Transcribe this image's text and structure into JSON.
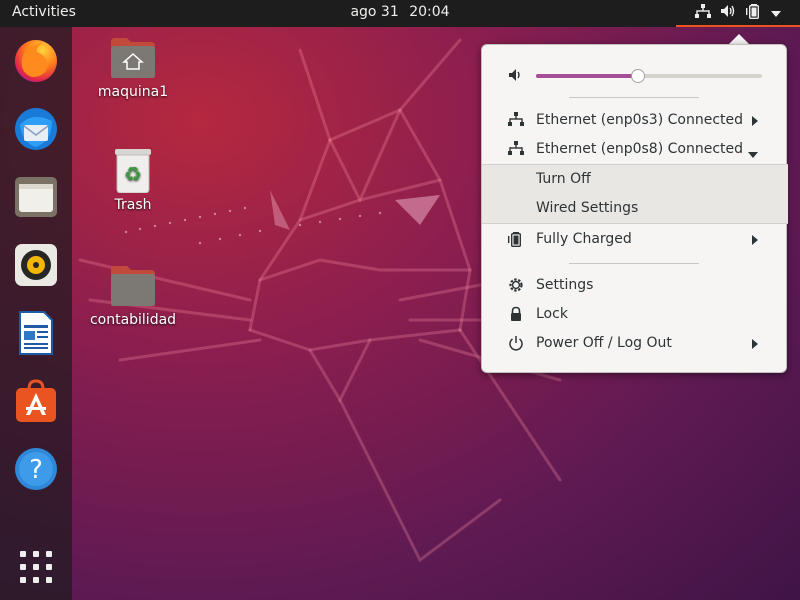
{
  "topbar": {
    "activities": "Activities",
    "date": "ago 31",
    "time": "20:04",
    "tray_icons": [
      "network-wired-icon",
      "volume-icon",
      "battery-icon",
      "menu-arrow-icon"
    ]
  },
  "dock": {
    "items": [
      "firefox",
      "thunderbird",
      "files",
      "rhythmbox",
      "libreoffice-writer",
      "ubuntu-software",
      "help"
    ],
    "show_apps": "show-applications-icon"
  },
  "desktop": {
    "icons": [
      {
        "label": "maquina1",
        "icon": "home-folder-icon"
      },
      {
        "label": "Trash",
        "icon": "trash-icon"
      },
      {
        "label": "contabilidad",
        "icon": "folder-icon"
      }
    ]
  },
  "menu": {
    "volume": {
      "icon": "volume-icon",
      "level": 0.45
    },
    "eth1": {
      "label": "Ethernet (enp0s3) Connected",
      "icon": "network-wired-icon"
    },
    "eth2": {
      "label": "Ethernet (enp0s8) Connected",
      "icon": "network-wired-icon"
    },
    "turn_off": "Turn Off",
    "wired_settings": "Wired Settings",
    "battery": {
      "label": "Fully Charged",
      "icon": "battery-icon"
    },
    "settings": "Settings",
    "lock": "Lock",
    "power": "Power Off / Log Out"
  },
  "colors": {
    "accent": "#e95420",
    "slider_fill": "#a64d97",
    "topbar": "#1d1d1d"
  }
}
